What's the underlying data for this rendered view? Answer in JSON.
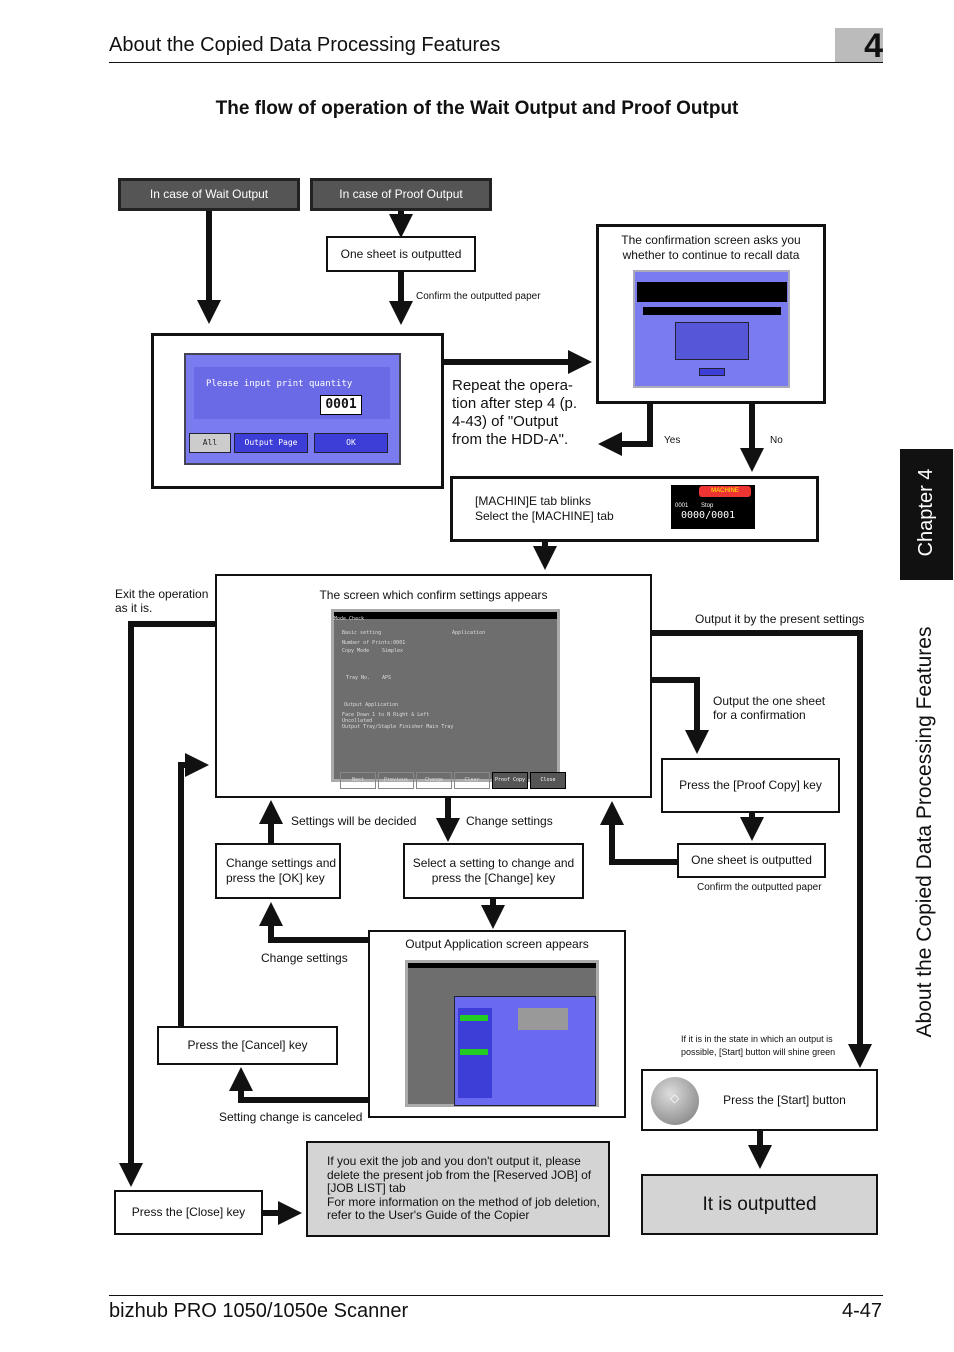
{
  "header": {
    "title": "About the Copied Data Processing Features",
    "chapter_number": "4"
  },
  "title": "The flow of operation of the Wait Output and Proof Output",
  "side_tab": {
    "chapter": "Chapter 4",
    "section": "About the Copied Data Processing Features"
  },
  "flow": {
    "wait_output": "In case of Wait Output",
    "proof_output": "In case of Proof Output",
    "one_sheet_top": "One sheet is outputted",
    "confirm_paper_top": "Confirm the outputted paper",
    "qty_screen": {
      "prompt": "Please input print quantity",
      "value": "0001",
      "all": "All",
      "output_page": "Output Page",
      "ok": "OK"
    },
    "confirm_screen": "The confirmation screen asks you whether to continue to recall data",
    "repeat": "Repeat the opera-tion after step 4 (p. 4-43) of \"Output from the HDD-A\".",
    "yes": "Yes",
    "no": "No",
    "machine_line1": "[MACHIN]E tab blinks",
    "machine_line2": "Select the [MACHINE] tab",
    "machine_screen": {
      "tab": "MACHINE",
      "job": "0001",
      "status": "Stop",
      "counter": "0000/0001"
    },
    "exit_op": "Exit the operation as it is.",
    "confirm_settings": "The screen which confirm settings appears",
    "mode_check": {
      "title": "Mode Check",
      "basic": "Basic setting",
      "application": "Application",
      "printers": "Number of Prints:0001",
      "copy_mode": "Copy Mode",
      "simplex": "Simplex",
      "tray": "Tray No.",
      "aps": "APS",
      "output_app": "Output Application",
      "info1": "Face Down   1 to N   Right & Left",
      "info2": "Uncollated",
      "info3": "Output Tray/Staple Finisher Main Tray",
      "buttons": [
        "Next",
        "Previous",
        "Change",
        "Clear",
        "Proof Copy",
        "Close"
      ]
    },
    "output_present": "Output it by the present settings",
    "output_one_sheet": "Output the one sheet for a confirmation",
    "press_proof": "Press the [Proof Copy] key",
    "one_sheet_right": "One sheet is outputted",
    "confirm_paper_right": "Confirm the outputted paper",
    "settings_decided": "Settings will be decided",
    "change_settings_1": "Change settings",
    "change_ok": "Change settings and press the [OK] key",
    "select_change": "Select a setting to change and press the [Change] key",
    "change_settings_2": "Change settings",
    "output_app_screen": "Output Application screen appears",
    "press_cancel": "Press the [Cancel] key",
    "setting_canceled": "Setting change is canceled",
    "start_note": "If it is in the state in which an output is possible, [Start] button will shine green",
    "press_start": "Press the [Start] button",
    "outputted": "It is outputted",
    "press_close": "Press the [Close] key",
    "note": "If you exit the job and you don't output it, please delete the present job from the [Reserved JOB] of [JOB LIST] tab\nFor more information on the method of job deletion, refer to the User's Guide of the Copier"
  },
  "footer": {
    "product": "bizhub PRO 1050/1050e Scanner",
    "page": "4-47"
  }
}
